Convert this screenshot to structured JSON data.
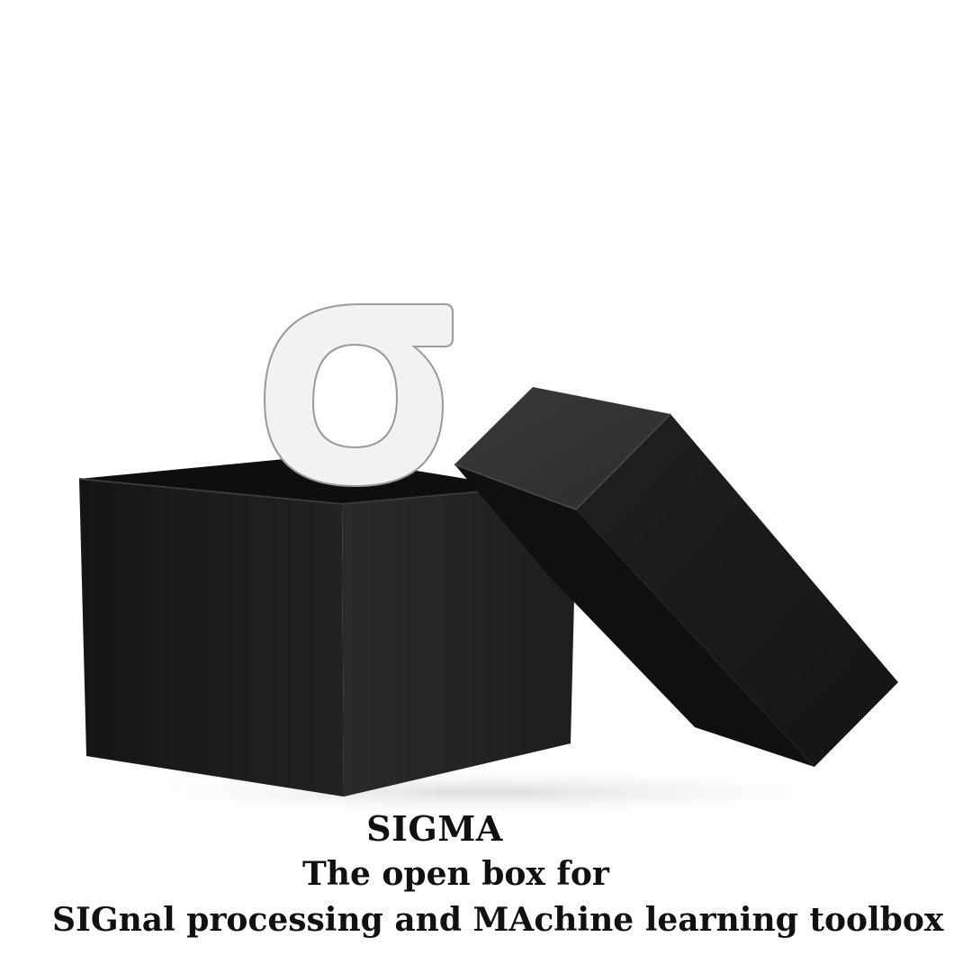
{
  "logo": {
    "glyph": "σ",
    "glyph_color": "#f2f2f2",
    "glyph_outline": "#9a9a9a",
    "icon": "sigma-letter-icon"
  },
  "illustration": {
    "box_icon": "open-black-box-icon",
    "lid_icon": "box-lid-icon",
    "box_color": "#1c1c1c"
  },
  "caption": {
    "title": "SIGMA",
    "line1": "The open box for",
    "line2": "SIGnal processing and MAchine learning toolbox"
  }
}
